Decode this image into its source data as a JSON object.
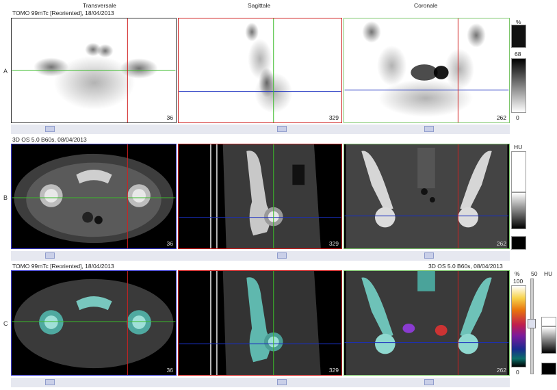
{
  "columns": {
    "transversal": "Transversale",
    "sagittal": "Sagittale",
    "coronal": "Coronale"
  },
  "rows": {
    "A": {
      "label": "A",
      "series": "TOMO 99mTc [Reoriented], 18/04/2013"
    },
    "B": {
      "label": "B",
      "series": "3D  OS  5.0  B60s, 08/04/2013"
    },
    "C": {
      "label": "C",
      "series": "TOMO 99mTc [Reoriented], 18/04/2013",
      "series_right": "3D  OS  5.0  B60s, 08/04/2013"
    }
  },
  "slices": {
    "transversal": "36",
    "sagittal": "329",
    "coronal": "262"
  },
  "scale_A": {
    "unit": "%",
    "value": "68",
    "min": "0"
  },
  "scale_B": {
    "unit": "HU"
  },
  "scale_C": {
    "pet_unit": "%",
    "pet_max": "100",
    "pet_min": "0",
    "fusion_value": "50",
    "ct_unit": "HU"
  },
  "colors": {
    "crosshair_v": "#d02020",
    "crosshair_h_A": "#3bbb2b",
    "crosshair_h_B": "#1a2fbf",
    "accent_panel": "#7cc66a"
  }
}
